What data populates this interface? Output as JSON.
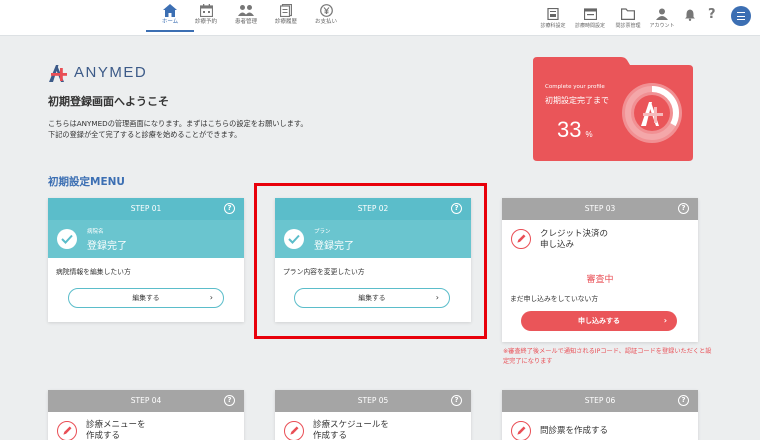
{
  "nav": {
    "items": [
      {
        "label": "ホーム",
        "icon": "home-icon",
        "active": true
      },
      {
        "label": "診療予約",
        "icon": "calendar-icon"
      },
      {
        "label": "患者管理",
        "icon": "patients-icon"
      },
      {
        "label": "診療履歴",
        "icon": "history-icon"
      },
      {
        "label": "お支払い",
        "icon": "payment-icon"
      }
    ],
    "right": [
      {
        "label": "診療科設定",
        "icon": "department-settings-icon"
      },
      {
        "label": "診療時間設定",
        "icon": "schedule-settings-icon"
      },
      {
        "label": "問診票管理",
        "icon": "questionnaire-folder-icon"
      },
      {
        "label": "アカウント",
        "icon": "account-icon"
      }
    ],
    "bell_icon": "bell-icon",
    "help_icon": "help-icon",
    "menu_icon": "hamburger-menu-icon",
    "accent": "#3c6fb3"
  },
  "logo": {
    "text": "ANYMED"
  },
  "welcome": {
    "title": "初期登録画面へようこそ",
    "line1": "こちらはANYMEDの管理画面になります。まずはこちらの設定をお願いします。",
    "line2": "下記の登録が全て完了すると診療を始めることができます。"
  },
  "progress": {
    "caption_en": "Complete your profile",
    "caption_jp": "初期設定完了まで",
    "value": "33",
    "unit": "%",
    "fraction": 0.33,
    "color": "#ea5559"
  },
  "section": {
    "title": "初期設定MENU"
  },
  "steps": [
    {
      "step": "STEP 01",
      "small": "病院名",
      "status": "登録完了",
      "desc": "病院情報を編集したい方",
      "button": "編集する"
    },
    {
      "step": "STEP 02",
      "small": "プラン",
      "status": "登録完了",
      "desc": "プラン内容を変更したい方",
      "button": "編集する"
    },
    {
      "step": "STEP 03",
      "title": "クレジット決済の\n申し込み",
      "status": "審査中",
      "desc": "まだ申し込みをしていない方",
      "button": "申し込みする"
    },
    {
      "step": "STEP 04",
      "title": "診療メニューを\n作成する"
    },
    {
      "step": "STEP 05",
      "title": "診療スケジュールを\n作成する"
    },
    {
      "step": "STEP 06",
      "title": "問診票を作成する"
    }
  ],
  "note": "※審査終了後メールで通知されるIPコード、認証コードを登録いただくと設定完了になります",
  "help_glyph": "?",
  "chevron": "›",
  "colors": {
    "teal": "#5bbdca",
    "gray": "#a5a5a5",
    "red": "#e94e55"
  }
}
